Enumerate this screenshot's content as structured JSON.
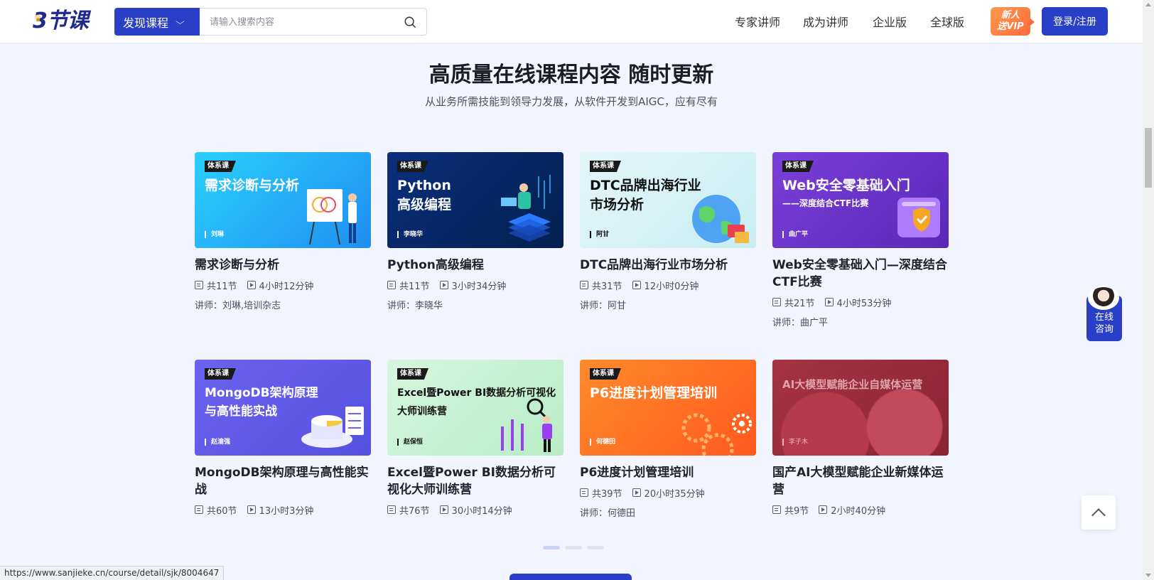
{
  "header": {
    "logo_text": "3节课",
    "discover_label": "发现课程",
    "search_placeholder": "请输入搜索内容",
    "nav": [
      "专家讲师",
      "成为讲师",
      "企业版",
      "全球版"
    ],
    "vip_line1": "新人",
    "vip_line2": "送VIP",
    "login_label": "登录/注册",
    "brand_color": "#2a3fc7"
  },
  "section": {
    "title": "高质量在线课程内容 随时更新",
    "subtitle": "从业务所需技能到领导力发展，从软件开发到AIGC，应有尽有"
  },
  "courses": [
    {
      "tag": "体系课",
      "thumb_title": "需求诊断与分析",
      "thumb_teacher": "刘琳",
      "title": "需求诊断与分析",
      "lessons": "共11节",
      "duration": "4小时12分钟",
      "teacher": "讲师：刘琳,培训杂志",
      "bg": "#27b6f5"
    },
    {
      "tag": "体系课",
      "thumb_title": "Python\n高级编程",
      "thumb_teacher": "李晓华",
      "title": "Python高级编程",
      "lessons": "共11节",
      "duration": "3小时34分钟",
      "teacher": "讲师：李晓华",
      "bg": "#0b2f78"
    },
    {
      "tag": "体系课",
      "thumb_title": "DTC品牌出海行业\n市场分析",
      "thumb_teacher": "阿甘",
      "title": "DTC品牌出海行业市场分析",
      "lessons": "共31节",
      "duration": "12小时0分钟",
      "teacher": "讲师：阿甘",
      "bg": "#d6f0f4"
    },
    {
      "tag": "体系课",
      "thumb_title": "Web安全零基础入门",
      "thumb_sub": "——深度结合CTF比赛",
      "thumb_teacher": "曲广平",
      "title": "Web安全零基础入门—深度结合CTF比赛",
      "lessons": "共21节",
      "duration": "4小时53分钟",
      "teacher": "讲师：曲广平",
      "bg": "#6a33c9"
    },
    {
      "tag": "体系课",
      "thumb_title": "MongoDB架构原理\n与高性能实战",
      "thumb_teacher": "赵渝强",
      "title": "MongoDB架构原理与高性能实战",
      "lessons": "共60节",
      "duration": "13小时3分钟",
      "teacher": "",
      "bg": "#5b5ce6"
    },
    {
      "tag": "体系课",
      "thumb_title": "Excel暨Power BI数据分析可视化\n大师训练营",
      "thumb_teacher": "赵保恒",
      "title": "Excel暨Power BI数据分析可视化大师训练营",
      "lessons": "共76节",
      "duration": "30小时14分钟",
      "teacher": "",
      "bg": "#c8f2d2"
    },
    {
      "tag": "体系课",
      "thumb_title": "P6进度计划管理培训",
      "thumb_teacher": "何德田",
      "title": "P6进度计划管理培训",
      "lessons": "共39节",
      "duration": "20小时35分钟",
      "teacher": "讲师：何德田",
      "bg": "#ff6a1f"
    },
    {
      "tag": "",
      "thumb_title": "AI大模型赋能企业自媒体运营",
      "thumb_teacher": "李子木",
      "title": "国产AI大模型赋能企业新媒体运营",
      "lessons": "共9节",
      "duration": "2小时40分钟",
      "teacher": "",
      "bg": "#a2323f"
    }
  ],
  "consult_label": "在线\n咨询",
  "status_url": "https://www.sanjieke.cn/course/detail/sjk/8004647"
}
